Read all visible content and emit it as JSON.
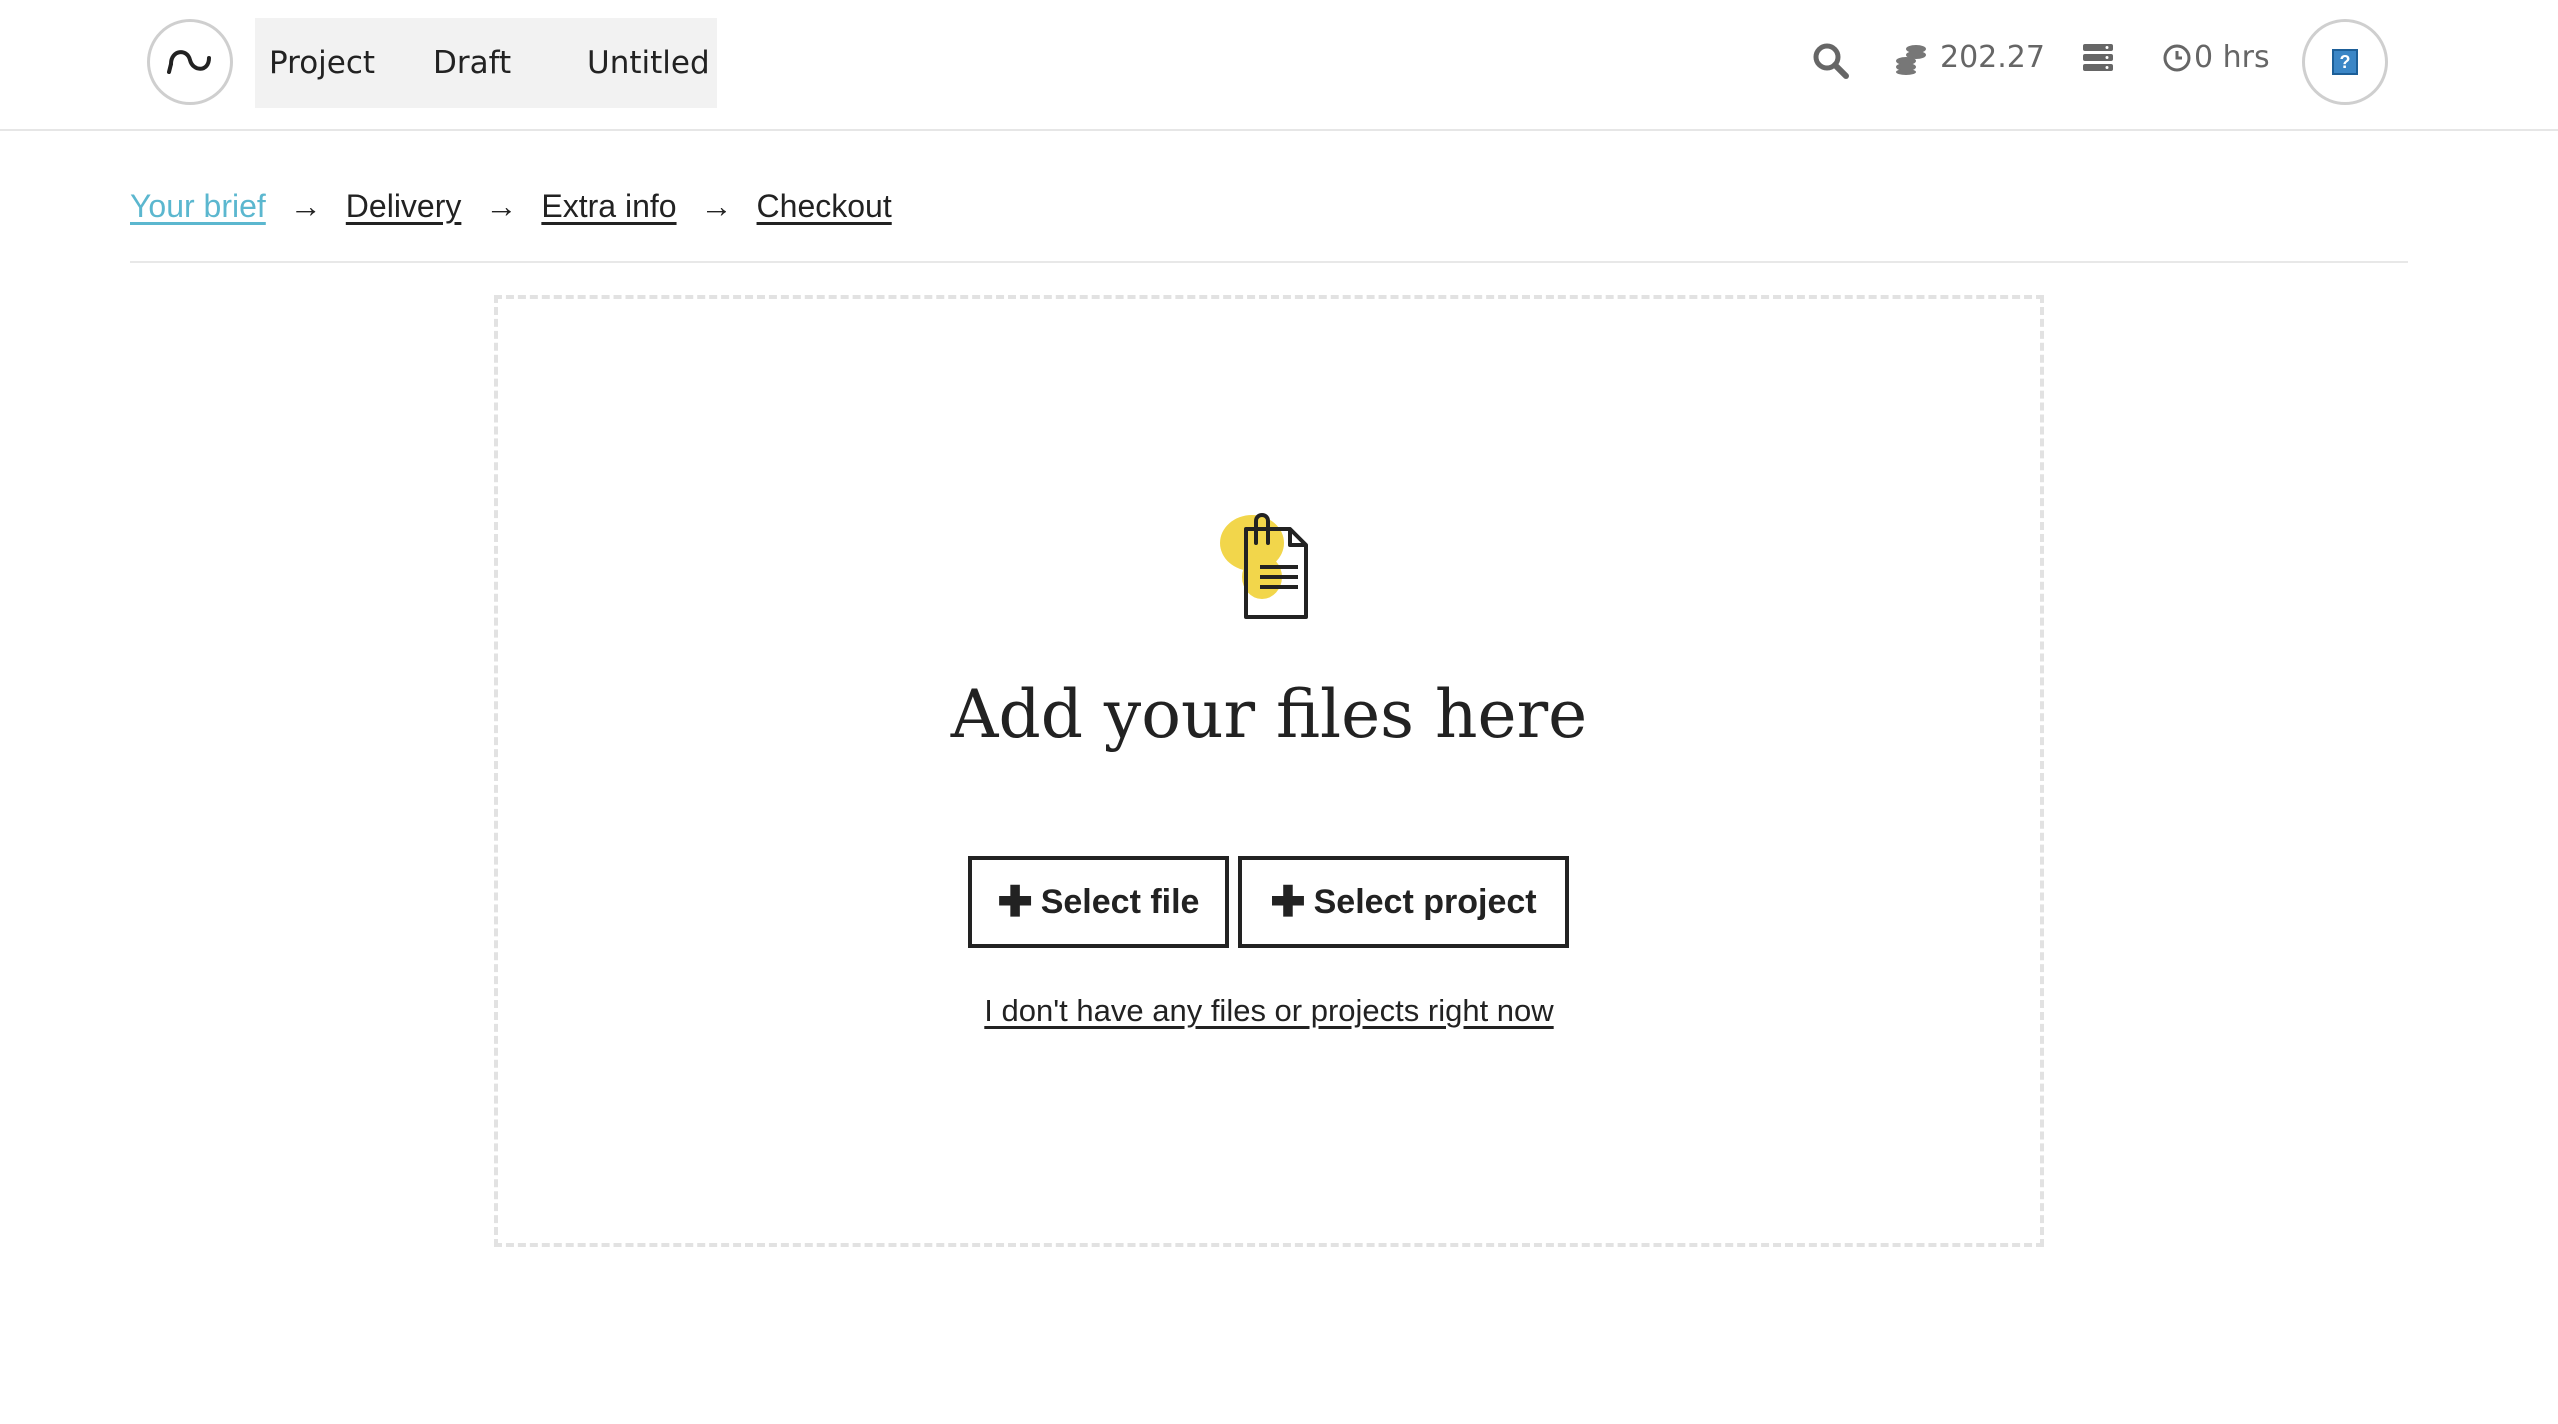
{
  "header": {
    "breadcrumbs": [
      {
        "label": "Project"
      },
      {
        "label": "Draft"
      },
      {
        "label": "Untitled"
      }
    ],
    "credits": "202.27",
    "hours": "0 hrs",
    "help_symbol": "?",
    "icons": {
      "logo": "swirl-logo-icon",
      "search": "search-icon",
      "credits": "coins-icon",
      "stack": "stack-icon",
      "clock": "clock-icon",
      "help": "help-icon"
    }
  },
  "steps": {
    "items": [
      {
        "label": "Your brief",
        "active": true
      },
      {
        "label": "Delivery",
        "active": false
      },
      {
        "label": "Extra info",
        "active": false
      },
      {
        "label": "Checkout",
        "active": false
      }
    ],
    "separator": "→"
  },
  "dropzone": {
    "icon": "document-clip-icon",
    "heading": "Add your files here",
    "select_file_label": "Select file",
    "select_project_label": "Select project",
    "no_files_link": "I don't have any files or projects right now"
  },
  "colors": {
    "accent_step": "#5bb7cf",
    "icon_highlight": "#f2d64b",
    "help_blue": "#3b86c6"
  }
}
